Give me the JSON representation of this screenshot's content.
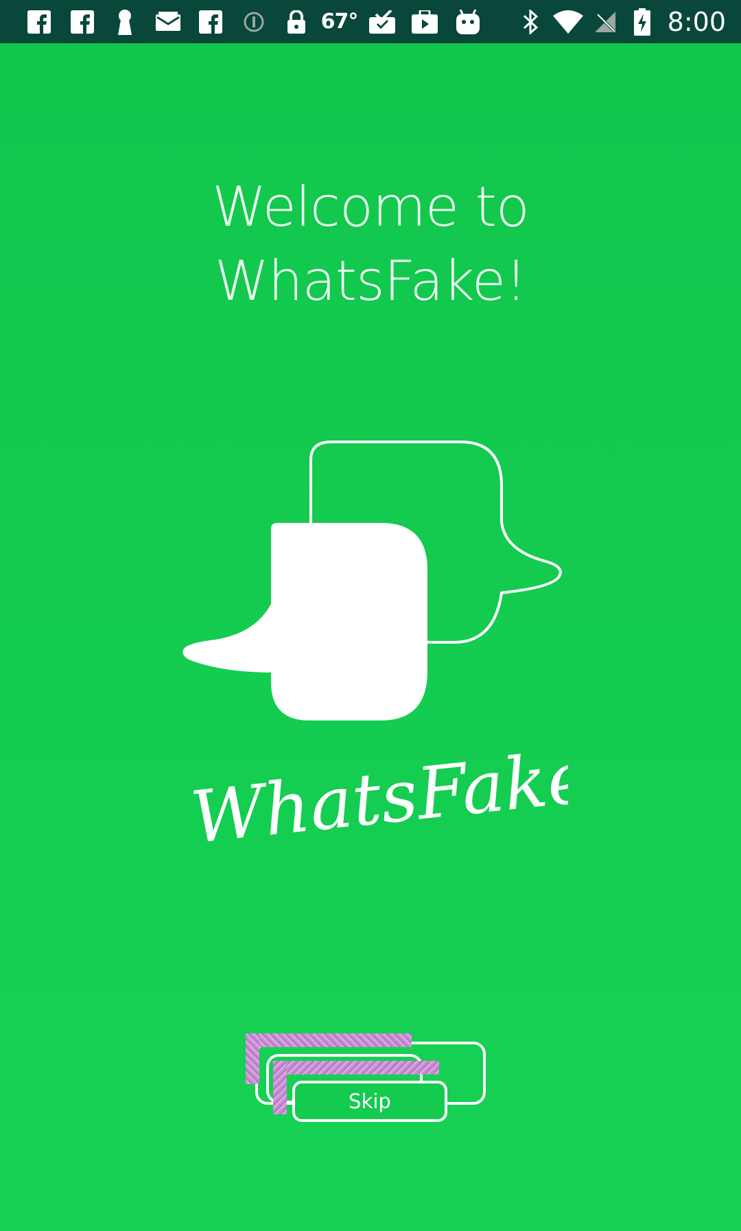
{
  "status_bar": {
    "left_icons": [
      "facebook-icon",
      "facebook-icon",
      "keyhole-icon",
      "mail-icon",
      "facebook-icon",
      "info-circle-icon",
      "lock-icon"
    ],
    "temperature": "67°",
    "right_icons": [
      "task-check-icon",
      "briefcase-play-icon",
      "android-icon",
      "bluetooth-icon",
      "wifi-icon",
      "no-signal-icon",
      "battery-charging-icon"
    ],
    "time": "8:00",
    "background_color": "#08473a"
  },
  "welcome": {
    "line1": "Welcome to",
    "line2": "WhatsFake!"
  },
  "logo": {
    "icon": "chat-bubbles-icon",
    "wordmark": "WhatsFake"
  },
  "actions": {
    "skip_label": "Skip"
  },
  "colors": {
    "background": "#14cc50",
    "foreground": "#ffffff"
  }
}
